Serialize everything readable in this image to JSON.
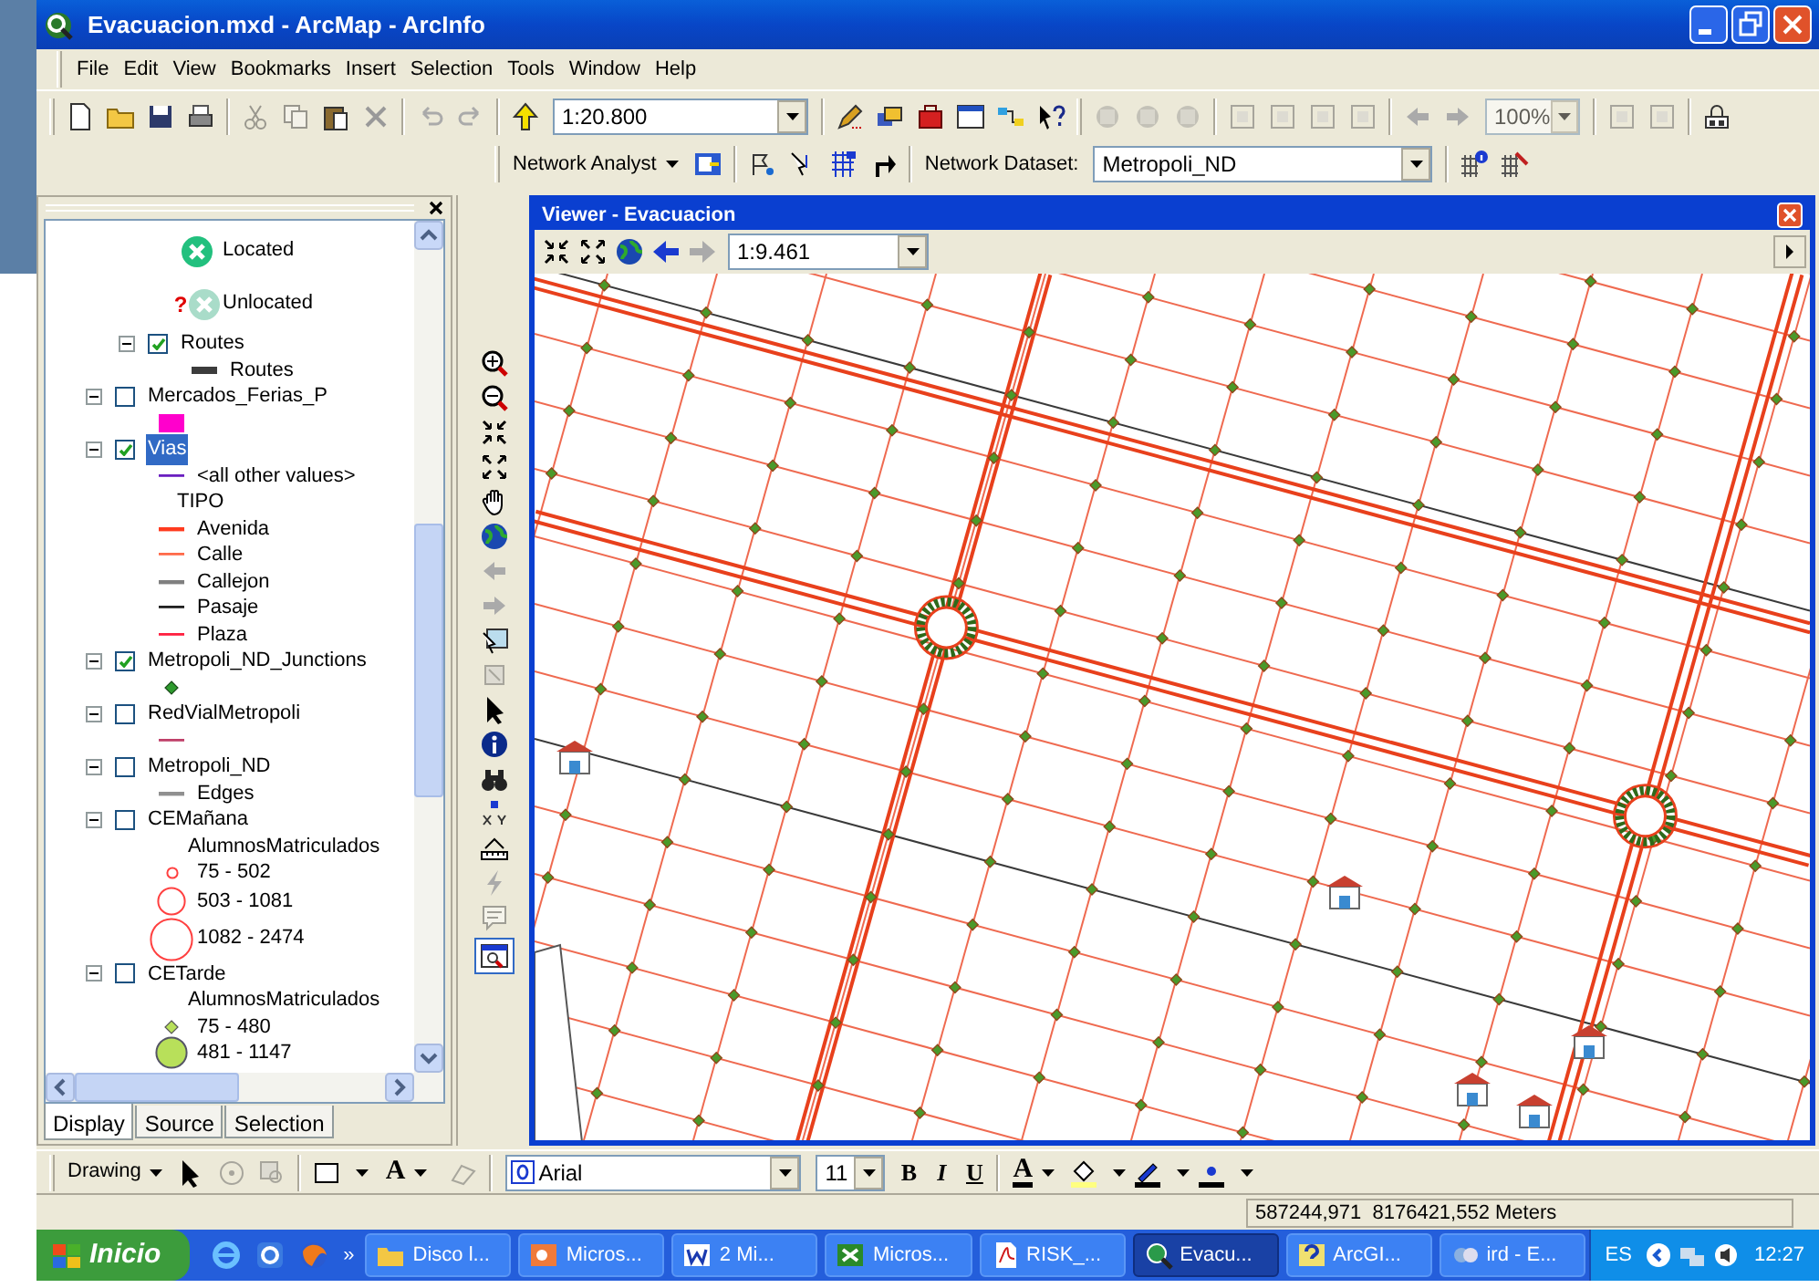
{
  "window": {
    "title": "Evacuacion.mxd - ArcMap - ArcInfo"
  },
  "menu": [
    "File",
    "Edit",
    "View",
    "Bookmarks",
    "Insert",
    "Selection",
    "Tools",
    "Window",
    "Help"
  ],
  "standard_toolbar": {
    "scale": "1:20.800",
    "zoom_percent": "100%"
  },
  "network_toolbar": {
    "label": "Network Analyst",
    "dataset_label": "Network Dataset:",
    "dataset": "Metropoli_ND"
  },
  "toc": {
    "items": [
      {
        "legend": [
          {
            "kind": "marker",
            "label": "Located",
            "color": "#22c07e"
          },
          {
            "kind": "marker-unlocated",
            "label": "Unlocated",
            "color": "#a9dcc9",
            "mark": "?"
          }
        ],
        "children": [
          {
            "name": "Routes",
            "checked": true,
            "expanded": true,
            "selected": false,
            "legend": [
              {
                "kind": "bar",
                "label": "Routes",
                "color": "#3c3c3c"
              }
            ]
          }
        ]
      },
      {
        "name": "Mercados_Ferias_P",
        "checked": false,
        "expanded": true,
        "selected": false,
        "legend": [
          {
            "kind": "fill",
            "color": "#ff00cc"
          }
        ]
      },
      {
        "name": "Vias",
        "checked": true,
        "expanded": true,
        "selected": true,
        "legend": [
          {
            "kind": "line",
            "label": "<all other values>",
            "color": "#6a1fc0"
          },
          {
            "kind": "heading",
            "label": "TIPO"
          },
          {
            "kind": "line-thick",
            "label": "Avenida",
            "color": "#ff3b1f"
          },
          {
            "kind": "line",
            "label": "Calle",
            "color": "#ff6a4a"
          },
          {
            "kind": "line-thick",
            "label": "Callejon",
            "color": "#808080"
          },
          {
            "kind": "line",
            "label": "Pasaje",
            "color": "#202020"
          },
          {
            "kind": "line",
            "label": "Plaza",
            "color": "#ff2040"
          }
        ]
      },
      {
        "name": "Metropoli_ND_Junctions",
        "checked": true,
        "expanded": true,
        "selected": false,
        "legend": [
          {
            "kind": "dot",
            "color": "#2e9a2e"
          }
        ]
      },
      {
        "name": "RedVialMetropoli",
        "checked": false,
        "expanded": true,
        "selected": false,
        "legend": [
          {
            "kind": "line",
            "color": "#c0406a"
          }
        ]
      },
      {
        "name": "Metropoli_ND",
        "checked": false,
        "expanded": true,
        "selected": false,
        "legend": [
          {
            "kind": "line-thick",
            "label": "Edges",
            "color": "#909090"
          }
        ]
      },
      {
        "name": "CEMañana",
        "checked": false,
        "expanded": true,
        "selected": false,
        "legend": [
          {
            "kind": "subheading",
            "label": "AlumnosMatriculados"
          },
          {
            "kind": "circle-small",
            "label": "75 - 502",
            "color": "#ff4040"
          },
          {
            "kind": "circle-medium",
            "label": "503 - 1081",
            "color": "#ff4040"
          },
          {
            "kind": "circle-large",
            "label": "1082 - 2474",
            "color": "#ff4040"
          }
        ]
      },
      {
        "name": "CETarde",
        "checked": false,
        "expanded": true,
        "selected": false,
        "legend": [
          {
            "kind": "subheading",
            "label": "AlumnosMatriculados"
          },
          {
            "kind": "diamond",
            "label": "75 - 480",
            "color": "#b8e05a"
          },
          {
            "kind": "circle-filled",
            "label": "481 - 1147",
            "color": "#b8e05a"
          }
        ]
      }
    ],
    "tabs": [
      {
        "label": "Display",
        "selected": true
      },
      {
        "label": "Source",
        "selected": false
      },
      {
        "label": "Selection",
        "selected": false
      }
    ]
  },
  "viewer": {
    "title": "Viewer - Evacuacion",
    "scale": "1:9.461"
  },
  "drawing_toolbar": {
    "label": "Drawing",
    "text_tool": "A",
    "font": "Arial",
    "size": "11",
    "format": [
      "B",
      "I",
      "U"
    ],
    "font_color": "A"
  },
  "status_bar": {
    "coordinates": "587244,971  8176421,552 Meters"
  },
  "taskbar": {
    "start": "Inicio",
    "more": "»",
    "tasks": [
      {
        "label": "Disco l...",
        "selected": false,
        "kind": "folder"
      },
      {
        "label": "Micros...",
        "selected": false,
        "kind": "outlook"
      },
      {
        "label": "2 Mi...",
        "selected": false,
        "kind": "word"
      },
      {
        "label": "Micros...",
        "selected": false,
        "kind": "excel"
      },
      {
        "label": "RISK_...",
        "selected": false,
        "kind": "pdf"
      },
      {
        "label": "Evacu...",
        "selected": true,
        "kind": "arcmap"
      },
      {
        "label": "ArcGI...",
        "selected": false,
        "kind": "help"
      },
      {
        "label": "ird - E...",
        "selected": false,
        "kind": "app"
      }
    ],
    "language": "ES",
    "clock": "12:27"
  }
}
